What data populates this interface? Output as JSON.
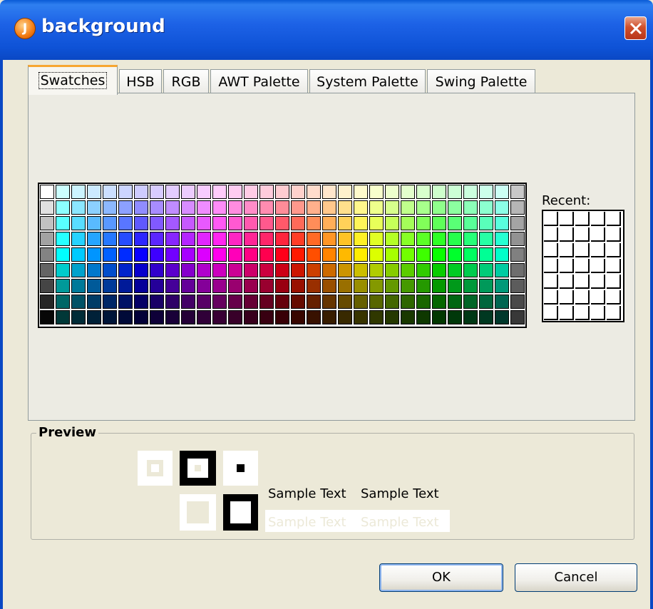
{
  "window": {
    "title": "background",
    "app_icon_letter": "J",
    "close_icon": "close-icon"
  },
  "tabs": [
    {
      "label": "Swatches",
      "active": true
    },
    {
      "label": "HSB"
    },
    {
      "label": "RGB"
    },
    {
      "label": "AWT Palette"
    },
    {
      "label": "System Palette"
    },
    {
      "label": "Swing Palette"
    }
  ],
  "swatches": {
    "recent_label": "Recent:",
    "columns": 31,
    "rows": 9,
    "recent_columns": 5,
    "recent_rows": 7
  },
  "preview": {
    "label": "Preview",
    "sample_text": [
      "Sample Text",
      "Sample Text",
      "Sample Text",
      "Sample Text"
    ],
    "selected_color": "#ffffff"
  },
  "buttons": {
    "ok": "OK",
    "cancel": "Cancel"
  }
}
